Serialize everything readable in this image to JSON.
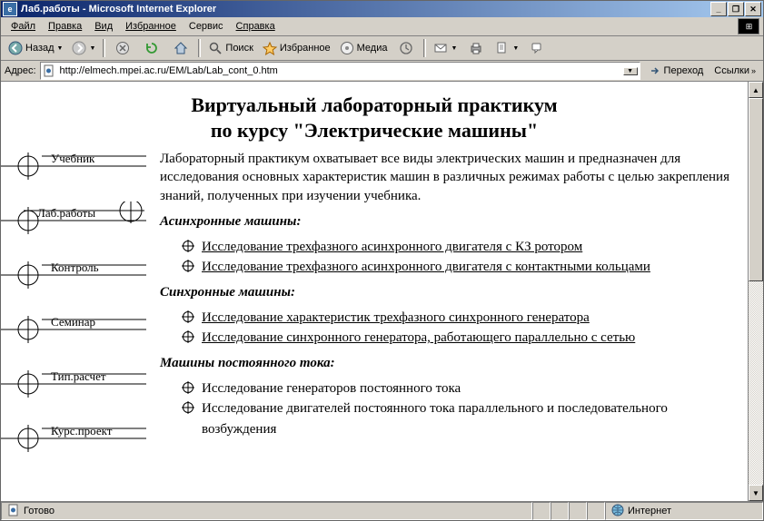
{
  "window": {
    "title": "Лаб.работы - Microsoft Internet Explorer"
  },
  "menu": {
    "file": "Файл",
    "edit": "Правка",
    "view": "Вид",
    "favorites": "Избранное",
    "tools": "Сервис",
    "help": "Справка"
  },
  "toolbar": {
    "back": "Назад",
    "search": "Поиск",
    "favorites": "Избранное",
    "media": "Медиа"
  },
  "address": {
    "label": "Адрес:",
    "value": "http://elmech.mpei.ac.ru/EM/Lab/Lab_cont_0.htm",
    "go": "Переход",
    "links": "Ссылки"
  },
  "page": {
    "title_line1": "Виртуальный лабораторный практикум",
    "title_line2": "по курсу \"Электрические машины\"",
    "intro": "Лабораторный практикум охватывает все виды электрических машин и предназначен для исследования основных характеристик машин в различных режимах работы с целью закрепления знаний, полученных при изучении учебника.",
    "nav": {
      "textbook": "Учебник",
      "labs": "Лаб.работы",
      "control": "Контроль",
      "seminar": "Семинар",
      "typcalc": "Тип.расчет",
      "courseproj": "Курс.проект"
    },
    "sections": {
      "async": {
        "title": "Асинхронные машины",
        "items": [
          "Исследование трехфазного асинхронного двигателя с КЗ ротором",
          "Исследование трехфазного асинхронного двигателя с контактными кольцами"
        ]
      },
      "sync": {
        "title": "Синхронные машины",
        "items": [
          "Исследование характеристик трехфазного синхронного генератора",
          "Исследование синхронного генератора, работающего параллельно с сетью"
        ]
      },
      "dc": {
        "title": "Машины постоянного тока",
        "items": [
          "Исследование генераторов постоянного тока",
          "Исследование двигателей постоянного тока параллельного и последовательного возбуждения"
        ]
      }
    }
  },
  "status": {
    "ready": "Готово",
    "zone": "Интернет"
  }
}
